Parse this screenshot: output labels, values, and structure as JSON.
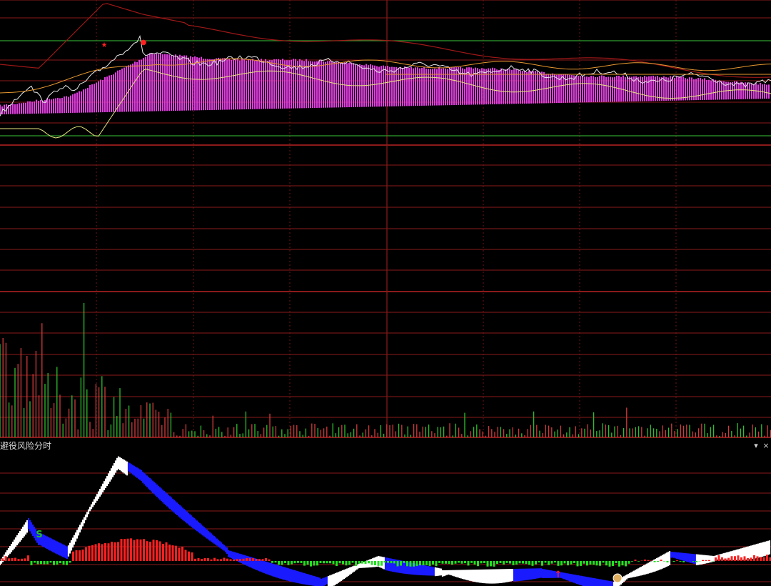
{
  "indicator_panel": {
    "title": "避役风险分时",
    "dropdown_icon": "caret-down-icon",
    "close_icon": "close-icon"
  },
  "colors": {
    "background": "#000000",
    "grid": "#8b1a1a",
    "green_band": "#2e9e2e",
    "volume_up": "#d23c3c",
    "volume_down": "#2fbf2f",
    "magenta_fill": "#e040e0",
    "risk_white": "#ffffff",
    "risk_blue": "#1a1aff",
    "risk_hist_red": "#ff2020",
    "risk_hist_green": "#20e020",
    "price_line": "#e8e8e8",
    "avg_line": "#e8e880",
    "upper_band": "#a01818",
    "orange_line": "#e89830"
  },
  "chart_data": [
    {
      "type": "line",
      "name": "intraday_price",
      "x": [
        0,
        24,
        48,
        72,
        96,
        120,
        144,
        168,
        192,
        216,
        240
      ],
      "series": [
        {
          "values": [
            0.1,
            0.35,
            0.15,
            0.4,
            0.72,
            0.85,
            0.98,
            0.92,
            0.8,
            0.68,
            0.62
          ]
        },
        {
          "values": [
            0.12,
            0.3,
            0.28,
            0.3,
            0.45,
            0.65,
            0.78,
            0.85,
            0.8,
            0.7,
            0.65
          ]
        }
      ],
      "markers": [
        {
          "label": "★",
          "color": "#ff2020"
        },
        {
          "label": "●",
          "color": "#ff2020"
        }
      ],
      "grid": true
    },
    {
      "type": "bar",
      "name": "volume",
      "grid": true
    },
    {
      "type": "area",
      "name": "risk_indicator",
      "annotations": [
        {
          "label": "S",
          "color": "#20c020"
        },
        {
          "label": "↑",
          "color": "#ff2020"
        }
      ]
    }
  ]
}
